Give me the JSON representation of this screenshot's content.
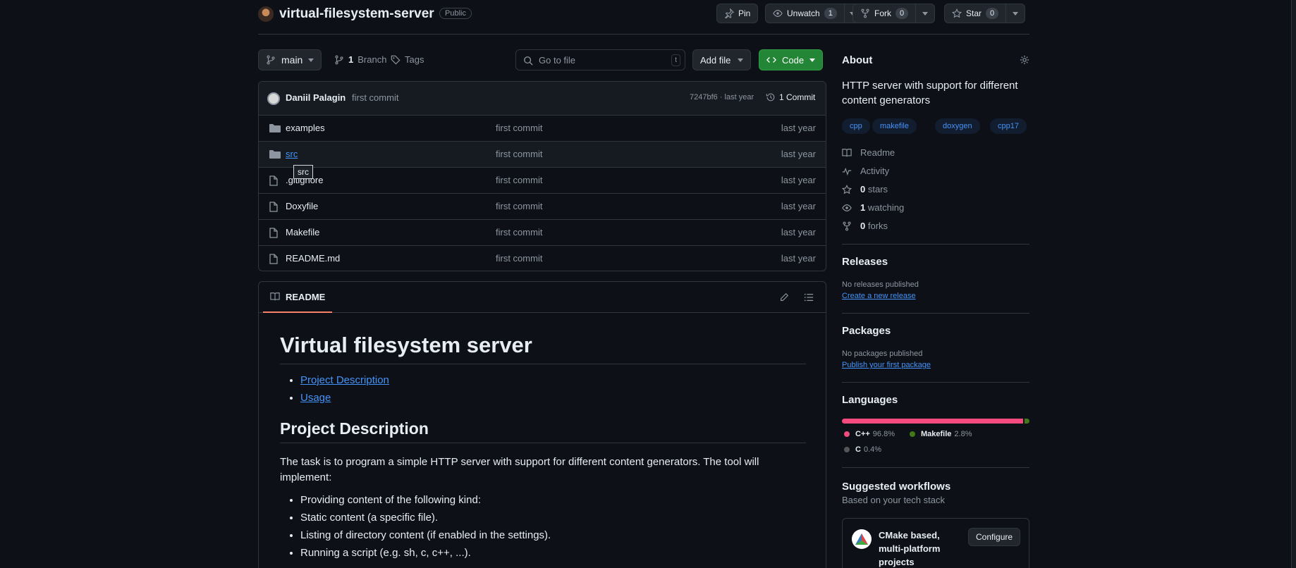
{
  "repo": {
    "name": "virtual-filesystem-server",
    "visibility": "Public"
  },
  "header_actions": {
    "pin_label": "Pin",
    "unwatch_label": "Unwatch",
    "watch_count": "1",
    "fork_label": "Fork",
    "fork_count": "0",
    "star_label": "Star",
    "star_count": "0"
  },
  "toolbar": {
    "branch": "main",
    "branch_count": "1",
    "branch_label": "Branch",
    "tags_label": "Tags",
    "search_placeholder": "Go to file",
    "search_shortcut": "t",
    "add_file_label": "Add file",
    "code_label": "Code"
  },
  "commit": {
    "author": "Daniil Palagin",
    "message": "first commit",
    "hash_time": "7247bf6 · last year",
    "commit_count": "1 Commit"
  },
  "files": [
    {
      "name": "examples",
      "type": "folder",
      "message": "first commit",
      "date": "last year"
    },
    {
      "name": "src",
      "type": "folder",
      "message": "first commit",
      "date": "last year"
    },
    {
      "name": ".gitignore",
      "type": "file",
      "message": "first commit",
      "date": "last year"
    },
    {
      "name": "Doxyfile",
      "type": "file",
      "message": "first commit",
      "date": "last year"
    },
    {
      "name": "Makefile",
      "type": "file",
      "message": "first commit",
      "date": "last year"
    },
    {
      "name": "README.md",
      "type": "file",
      "message": "first commit",
      "date": "last year"
    }
  ],
  "tooltip": "src",
  "readme": {
    "tab_label": "README",
    "title": "Virtual filesystem server",
    "toc": [
      "Project Description",
      "Usage"
    ],
    "section_title": "Project Description",
    "paragraph": "The task is to program a simple HTTP server with support for different content generators. The tool will implement:",
    "bullets": [
      "Providing content of the following kind:",
      "Static content (a specific file).",
      "Listing of directory content (if enabled in the settings).",
      "Running a script (e.g. sh, c, c++, ...)."
    ]
  },
  "about": {
    "title": "About",
    "description": "HTTP server with support for different content generators",
    "topics": [
      "cpp",
      "makefile",
      "doxygen",
      "cpp17"
    ],
    "links": [
      {
        "icon": "book-icon",
        "label": "Readme"
      },
      {
        "icon": "pulse-icon",
        "label": "Activity"
      },
      {
        "icon": "star-icon",
        "count": "0",
        "label": "stars"
      },
      {
        "icon": "eye-icon",
        "count": "1",
        "label": "watching"
      },
      {
        "icon": "fork-icon",
        "count": "0",
        "label": "forks"
      }
    ]
  },
  "releases": {
    "title": "Releases",
    "text": "No releases published",
    "link": "Create a new release"
  },
  "packages": {
    "title": "Packages",
    "text": "No packages published",
    "link": "Publish your first package"
  },
  "languages": {
    "title": "Languages",
    "items": [
      {
        "name": "C++",
        "percent": "96.8%",
        "value": 96.8,
        "color": "#f34b7d"
      },
      {
        "name": "Makefile",
        "percent": "2.8%",
        "value": 2.8,
        "color": "#427819"
      },
      {
        "name": "C",
        "percent": "0.4%",
        "value": 0.4,
        "color": "#555555"
      }
    ]
  },
  "workflows": {
    "title": "Suggested workflows",
    "subtitle": "Based on your tech stack",
    "card_title": "CMake based, multi-platform projects",
    "configure_label": "Configure"
  },
  "colors": {
    "background": "#0d1117",
    "code_button": "#238636",
    "link": "#4493f8",
    "accent_underline": "#f78166"
  }
}
